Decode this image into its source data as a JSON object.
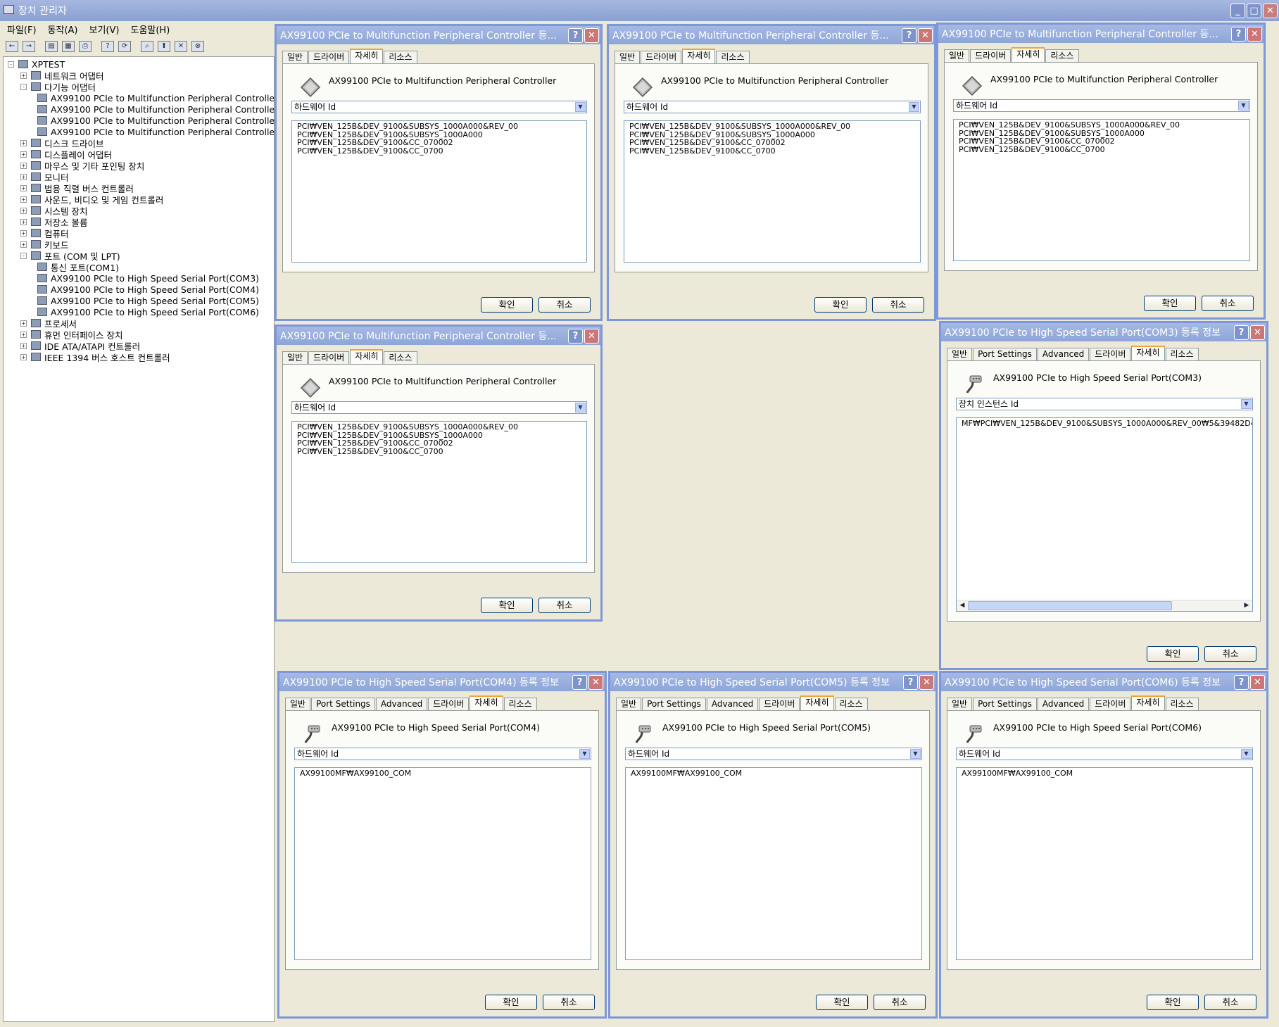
{
  "window": {
    "title": "장치 관리자"
  },
  "menu": [
    "파일(F)",
    "동작(A)",
    "보기(V)",
    "도움말(H)"
  ],
  "toolbar_icons": [
    "back-icon",
    "forward-icon",
    "console-icon",
    "properties-icon",
    "print-icon",
    "help-icon",
    "refresh-icon",
    "scan-icon",
    "update-driver-icon",
    "disable-icon",
    "uninstall-icon"
  ],
  "tree": [
    {
      "label": "XPTEST",
      "level": 0,
      "exp": "-"
    },
    {
      "label": "네트워크 어댑터",
      "level": 1,
      "exp": "+"
    },
    {
      "label": "다기능 어댑터",
      "level": 1,
      "exp": "-"
    },
    {
      "label": "AX99100 PCIe to Multifunction Peripheral Controller",
      "level": 2,
      "exp": ""
    },
    {
      "label": "AX99100 PCIe to Multifunction Peripheral Controller",
      "level": 2,
      "exp": ""
    },
    {
      "label": "AX99100 PCIe to Multifunction Peripheral Controller",
      "level": 2,
      "exp": ""
    },
    {
      "label": "AX99100 PCIe to Multifunction Peripheral Controller",
      "level": 2,
      "exp": ""
    },
    {
      "label": "디스크 드라이브",
      "level": 1,
      "exp": "+"
    },
    {
      "label": "디스플레이 어댑터",
      "level": 1,
      "exp": "+"
    },
    {
      "label": "마우스 및 기타 포인팅 장치",
      "level": 1,
      "exp": "+"
    },
    {
      "label": "모니터",
      "level": 1,
      "exp": "+"
    },
    {
      "label": "범용 직렬 버스 컨트롤러",
      "level": 1,
      "exp": "+"
    },
    {
      "label": "사운드, 비디오 및 게임 컨트롤러",
      "level": 1,
      "exp": "+"
    },
    {
      "label": "시스템 장치",
      "level": 1,
      "exp": "+"
    },
    {
      "label": "저장소 볼륨",
      "level": 1,
      "exp": "+"
    },
    {
      "label": "컴퓨터",
      "level": 1,
      "exp": "+"
    },
    {
      "label": "키보드",
      "level": 1,
      "exp": "+"
    },
    {
      "label": "포트 (COM 및 LPT)",
      "level": 1,
      "exp": "-"
    },
    {
      "label": "통신 포트(COM1)",
      "level": 2,
      "exp": ""
    },
    {
      "label": "AX99100 PCIe to High Speed Serial Port(COM3)",
      "level": 2,
      "exp": ""
    },
    {
      "label": "AX99100 PCIe to High Speed Serial Port(COM4)",
      "level": 2,
      "exp": ""
    },
    {
      "label": "AX99100 PCIe to High Speed Serial Port(COM5)",
      "level": 2,
      "exp": ""
    },
    {
      "label": "AX99100 PCIe to High Speed Serial Port(COM6)",
      "level": 2,
      "exp": ""
    },
    {
      "label": "프로세서",
      "level": 1,
      "exp": "+"
    },
    {
      "label": "휴먼 인터페이스 장치",
      "level": 1,
      "exp": "+"
    },
    {
      "label": "IDE ATA/ATAPI 컨트롤러",
      "level": 1,
      "exp": "+"
    },
    {
      "label": "IEEE 1394 버스 호스트 컨트롤러",
      "level": 1,
      "exp": "+"
    }
  ],
  "buttons": {
    "ok": "확인",
    "cancel": "취소"
  },
  "dialogs": [
    {
      "title": "AX99100 PCIe to Multifunction Peripheral Controller 등...",
      "tabs": [
        "일반",
        "드라이버",
        "자세히",
        "리소스"
      ],
      "active_tab": 2,
      "device": "AX99100 PCIe to Multifunction Peripheral Controller",
      "icon": "chip-icon",
      "property": "하드웨어 Id",
      "values": [
        "PCI₩VEN_125B&DEV_9100&SUBSYS_1000A000&REV_00",
        "PCI₩VEN_125B&DEV_9100&SUBSYS_1000A000",
        "PCI₩VEN_125B&DEV_9100&CC_070002",
        "PCI₩VEN_125B&DEV_9100&CC_0700"
      ],
      "hscroll": false
    },
    {
      "title": "AX99100 PCIe to Multifunction Peripheral Controller 등...",
      "tabs": [
        "일반",
        "드라이버",
        "자세히",
        "리소스"
      ],
      "active_tab": 2,
      "device": "AX99100 PCIe to Multifunction Peripheral Controller",
      "icon": "chip-icon",
      "property": "하드웨어 Id",
      "values": [
        "PCI₩VEN_125B&DEV_9100&SUBSYS_1000A000&REV_00",
        "PCI₩VEN_125B&DEV_9100&SUBSYS_1000A000",
        "PCI₩VEN_125B&DEV_9100&CC_070002",
        "PCI₩VEN_125B&DEV_9100&CC_0700"
      ],
      "hscroll": false
    },
    {
      "title": "AX99100 PCIe to Multifunction Peripheral Controller 등...",
      "tabs": [
        "일반",
        "드라이버",
        "자세히",
        "리소스"
      ],
      "active_tab": 2,
      "device": "AX99100 PCIe to Multifunction Peripheral Controller",
      "icon": "chip-icon",
      "property": "하드웨어 Id",
      "values": [
        "PCI₩VEN_125B&DEV_9100&SUBSYS_1000A000&REV_00",
        "PCI₩VEN_125B&DEV_9100&SUBSYS_1000A000",
        "PCI₩VEN_125B&DEV_9100&CC_070002",
        "PCI₩VEN_125B&DEV_9100&CC_0700"
      ],
      "hscroll": false
    },
    {
      "title": "AX99100 PCIe to Multifunction Peripheral Controller 등...",
      "tabs": [
        "일반",
        "드라이버",
        "자세히",
        "리소스"
      ],
      "active_tab": 2,
      "device": "AX99100 PCIe to Multifunction Peripheral Controller",
      "icon": "chip-icon",
      "property": "하드웨어 Id",
      "values": [
        "PCI₩VEN_125B&DEV_9100&SUBSYS_1000A000&REV_00",
        "PCI₩VEN_125B&DEV_9100&SUBSYS_1000A000",
        "PCI₩VEN_125B&DEV_9100&CC_070002",
        "PCI₩VEN_125B&DEV_9100&CC_0700"
      ],
      "hscroll": false
    },
    {
      "title": "AX99100 PCIe to High Speed Serial Port(COM3) 등록 정보",
      "tabs": [
        "일반",
        "Port Settings",
        "Advanced",
        "드라이버",
        "자세히",
        "리소스"
      ],
      "active_tab": 4,
      "device": "AX99100 PCIe to High Speed Serial Port(COM3)",
      "icon": "serial-port-icon",
      "property": "장치 인스턴스 Id",
      "values": [
        "MF₩PCI₩VEN_125B&DEV_9100&SUBSYS_1000A000&REV_00₩5&39482D4"
      ],
      "hscroll": true
    },
    {
      "title": "AX99100 PCIe to High Speed Serial Port(COM4) 등록 정보",
      "tabs": [
        "일반",
        "Port Settings",
        "Advanced",
        "드라이버",
        "자세히",
        "리소스"
      ],
      "active_tab": 4,
      "device": "AX99100 PCIe to High Speed Serial Port(COM4)",
      "icon": "serial-port-icon",
      "property": "하드웨어 Id",
      "values": [
        "AX99100MF₩AX99100_COM"
      ],
      "hscroll": false
    },
    {
      "title": "AX99100 PCIe to High Speed Serial Port(COM5) 등록 정보",
      "tabs": [
        "일반",
        "Port Settings",
        "Advanced",
        "드라이버",
        "자세히",
        "리소스"
      ],
      "active_tab": 4,
      "device": "AX99100 PCIe to High Speed Serial Port(COM5)",
      "icon": "serial-port-icon",
      "property": "하드웨어 Id",
      "values": [
        "AX99100MF₩AX99100_COM"
      ],
      "hscroll": false
    },
    {
      "title": "AX99100 PCIe to High Speed Serial Port(COM6) 등록 정보",
      "tabs": [
        "일반",
        "Port Settings",
        "Advanced",
        "드라이버",
        "자세히",
        "리소스"
      ],
      "active_tab": 4,
      "device": "AX99100 PCIe to High Speed Serial Port(COM6)",
      "icon": "serial-port-icon",
      "property": "하드웨어 Id",
      "values": [
        "AX99100MF₩AX99100_COM"
      ],
      "hscroll": false
    }
  ]
}
